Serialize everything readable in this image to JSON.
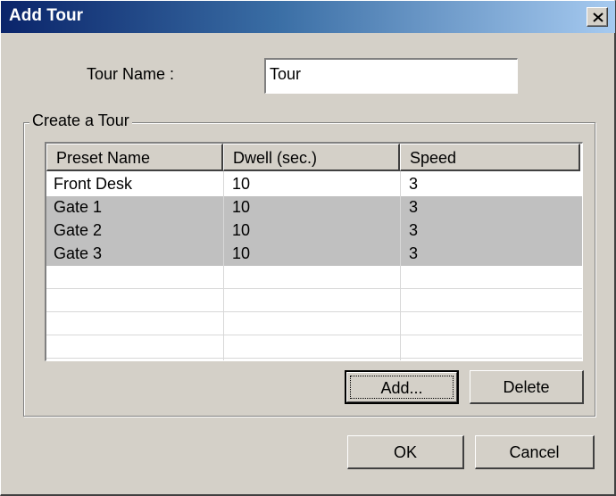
{
  "window": {
    "title": "Add Tour"
  },
  "tour_name": {
    "label": "Tour Name :",
    "value": "Tour"
  },
  "group": {
    "label": "Create a Tour"
  },
  "table": {
    "columns": [
      "Preset Name",
      "Dwell (sec.)",
      "Speed"
    ],
    "rows": [
      {
        "preset": "Front Desk",
        "dwell": "10",
        "speed": "3"
      },
      {
        "preset": "Gate 1",
        "dwell": "10",
        "speed": "3"
      },
      {
        "preset": "Gate 2",
        "dwell": "10",
        "speed": "3"
      },
      {
        "preset": "Gate 3",
        "dwell": "10",
        "speed": "3"
      }
    ]
  },
  "buttons": {
    "add": "Add...",
    "delete": "Delete",
    "ok": "OK",
    "cancel": "Cancel"
  },
  "icons": {
    "close": "close-icon"
  }
}
